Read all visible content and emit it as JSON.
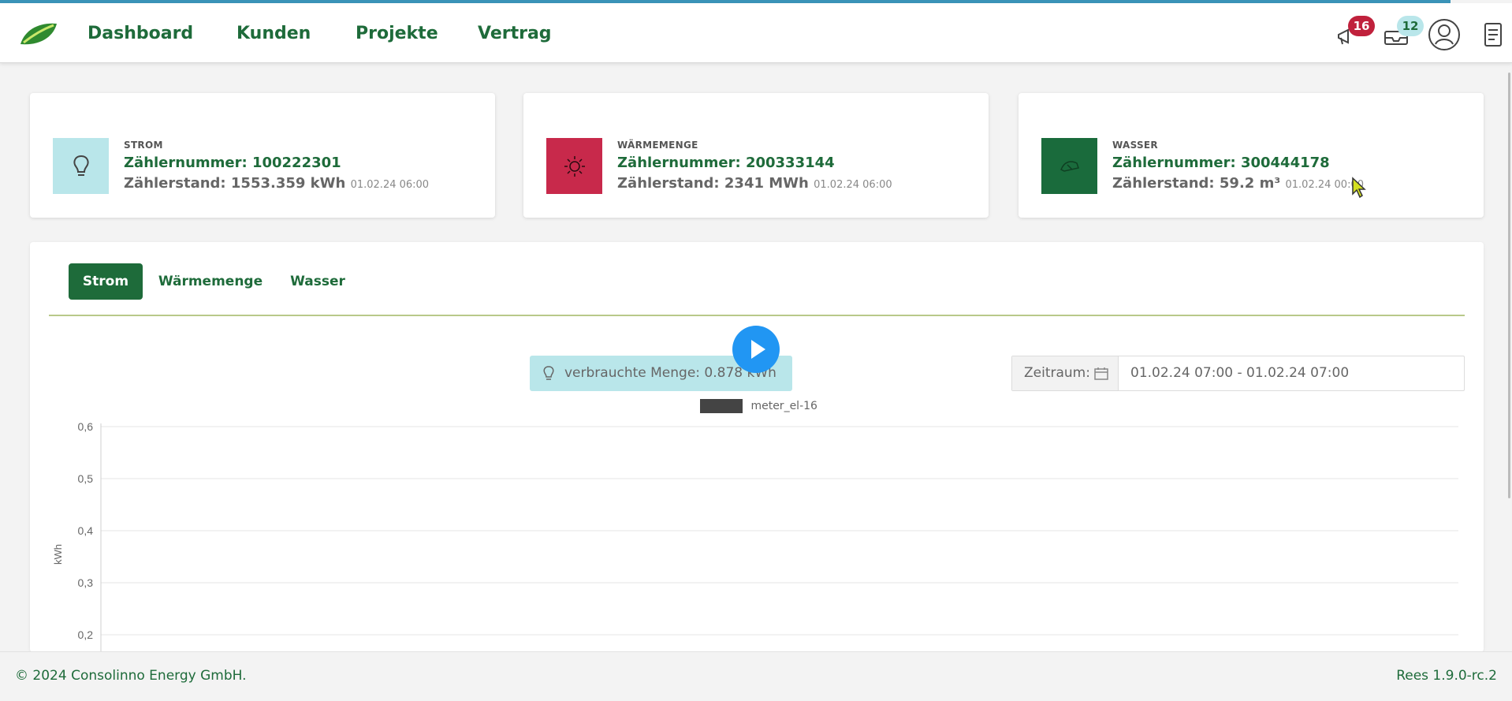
{
  "nav": {
    "links": [
      "Dashboard",
      "Kunden",
      "Projekte",
      "Vertrag"
    ],
    "badges": {
      "notifications": "16",
      "messages": "12"
    }
  },
  "meters": [
    {
      "type": "STROM",
      "number": "Zählernummer: 100222301",
      "stand": "Zählerstand: 1553.359 kWh",
      "time": "01.02.24 06:00",
      "color": "#b9e6ea",
      "icon": "lightbulb-icon"
    },
    {
      "type": "WÄRMEMENGE",
      "number": "Zählernummer: 200333144",
      "stand": "Zählerstand: 2341 MWh",
      "time": "01.02.24 06:00",
      "color": "#c8294b",
      "icon": "sun-icon"
    },
    {
      "type": "WASSER",
      "number": "Zählernummer: 300444178",
      "stand": "Zählerstand: 59.2 m³",
      "time": "01.02.24 00:00",
      "color": "#1a6b3c",
      "icon": "water-icon"
    }
  ],
  "tabs": [
    "Strom",
    "Wärmemenge",
    "Wasser"
  ],
  "consumed": "verbrauchte Menge:  0.878 kWh",
  "zeitraum": {
    "label": "Zeitraum:",
    "value": "01.02.24 07:00  - 01.02.24 07:00"
  },
  "chart_data": {
    "type": "line",
    "title": "",
    "xlabel": "",
    "ylabel": "kWh",
    "series": [
      {
        "name": "meter_el-16",
        "values": []
      }
    ],
    "yticks": [
      "0,6",
      "0,5",
      "0,4",
      "0,3",
      "0,2"
    ],
    "ylim": [
      0.2,
      0.6
    ],
    "grid": true,
    "legend": "top-center"
  },
  "footer": {
    "copyright": "© 2024 Consolinno Energy GmbH.",
    "version": "Rees 1.9.0-rc.2"
  },
  "colors": {
    "brand_green": "#1e6b3a",
    "accent_teal": "#b9e6ea",
    "alert_red": "#c0213c",
    "play_blue": "#2196f3"
  }
}
